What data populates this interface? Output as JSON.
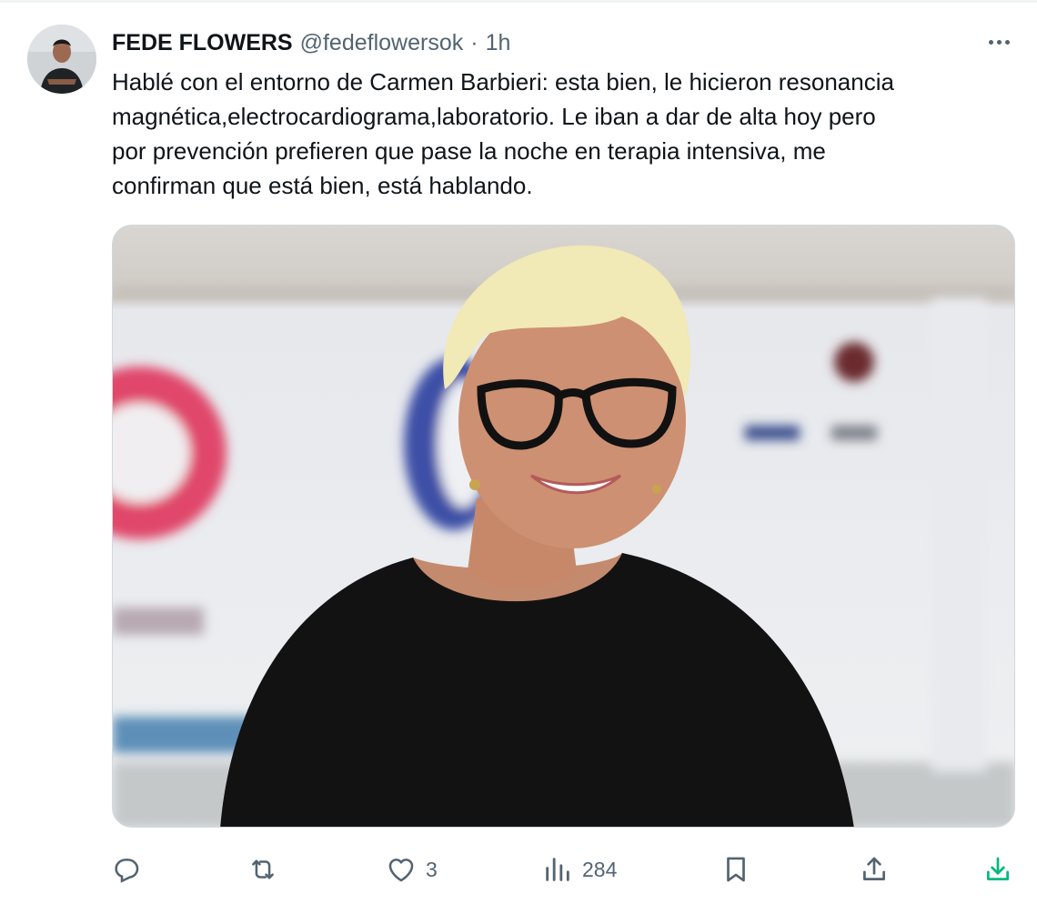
{
  "tweet": {
    "author_name": "FEDE FLOWERS",
    "author_handle": "@fedeflowersok",
    "separator": "·",
    "time": "1h",
    "text_lines": [
      "Hablé con el entorno de Carmen Barbieri: esta bien, le hicieron resonancia",
      "magnética,electrocardiograma,laboratorio. Le iban a dar de alta hoy pero",
      "por prevención prefieren que pase la noche en terapia intensiva, me",
      "confirman que está bien, está hablando."
    ]
  },
  "actions": {
    "reply": {
      "icon": "reply-icon",
      "count": ""
    },
    "retweet": {
      "icon": "retweet-icon",
      "count": ""
    },
    "like": {
      "icon": "heart-icon",
      "count": "3"
    },
    "views": {
      "icon": "views-chart-icon",
      "count": "284"
    },
    "bookmark": {
      "icon": "bookmark-icon"
    },
    "share": {
      "icon": "share-icon"
    },
    "download": {
      "icon": "download-icon",
      "color": "#00ba7c"
    }
  },
  "colors": {
    "text_primary": "#0f1419",
    "text_secondary": "#536471",
    "border": "#cfd9de",
    "download_accent": "#00ba7c"
  }
}
